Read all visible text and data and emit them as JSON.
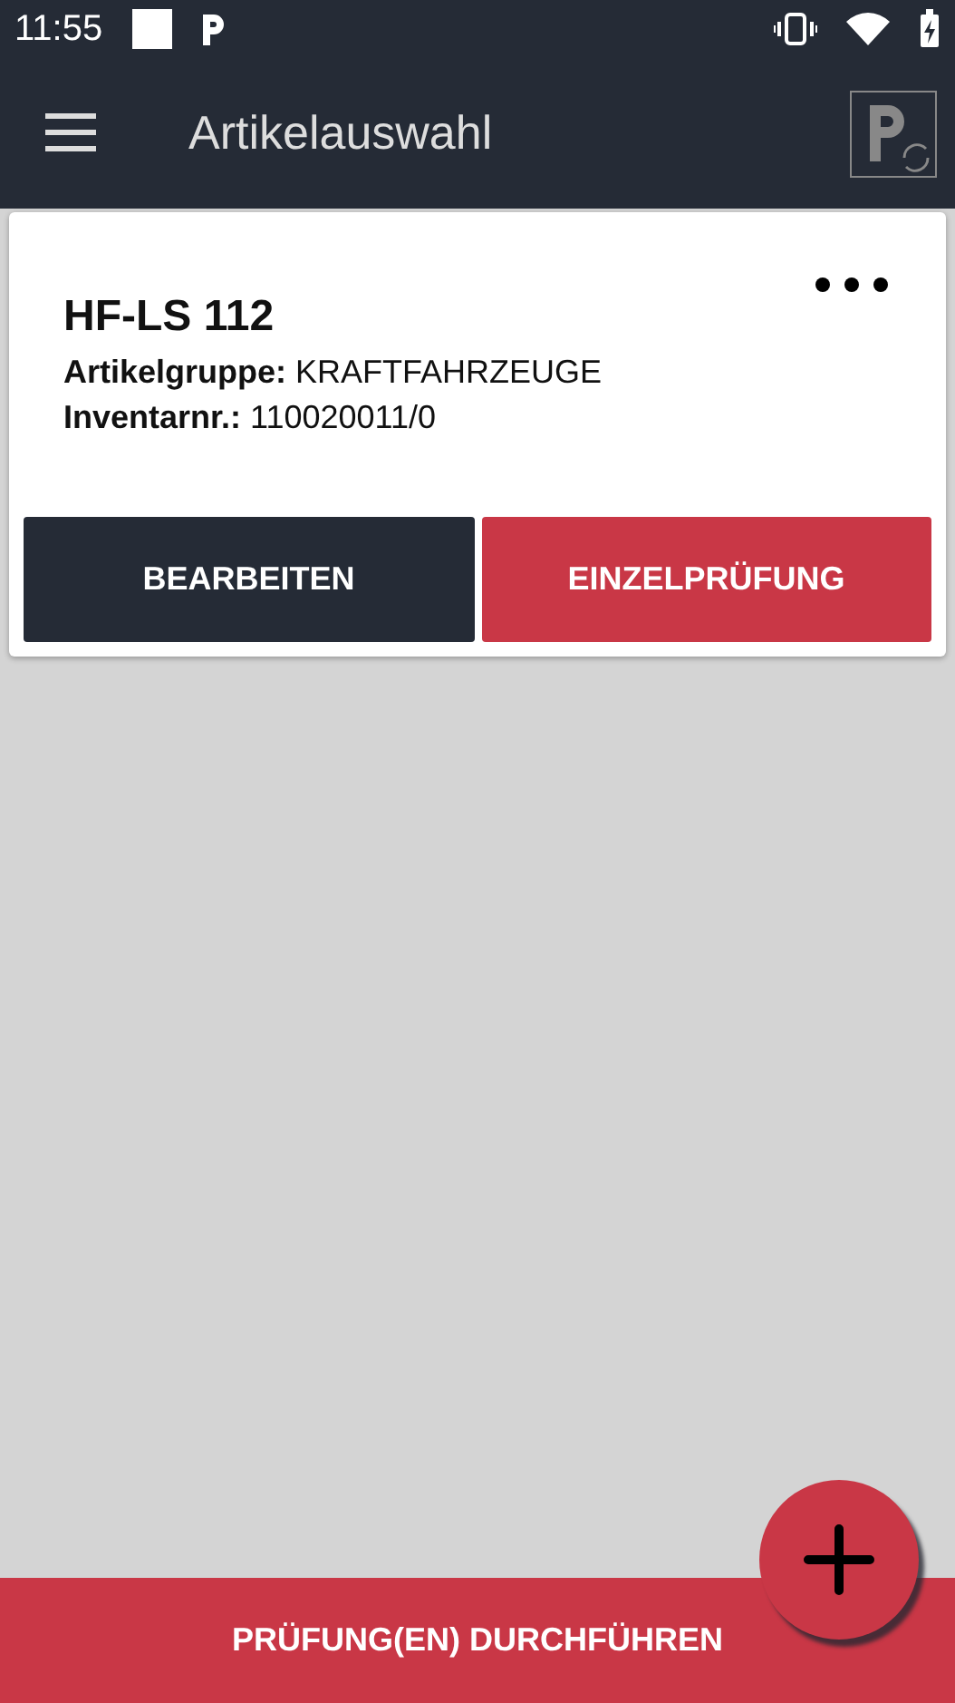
{
  "status_bar": {
    "time": "11:55"
  },
  "toolbar": {
    "title": "Artikelauswahl"
  },
  "items": [
    {
      "title": "HF-LS 112",
      "fields": [
        {
          "label": "Artikelgruppe:",
          "value": "KRAFTFAHRZEUGE"
        },
        {
          "label": "Inventarnr.:",
          "value": "110020011/0"
        }
      ],
      "buttons": [
        {
          "label": "BEARBEITEN",
          "kind": "dark"
        },
        {
          "label": "EINZELPRÜFUNG",
          "kind": "red"
        }
      ]
    }
  ],
  "bottom_button": "PRÜFUNG(EN) DURCHFÜHREN"
}
